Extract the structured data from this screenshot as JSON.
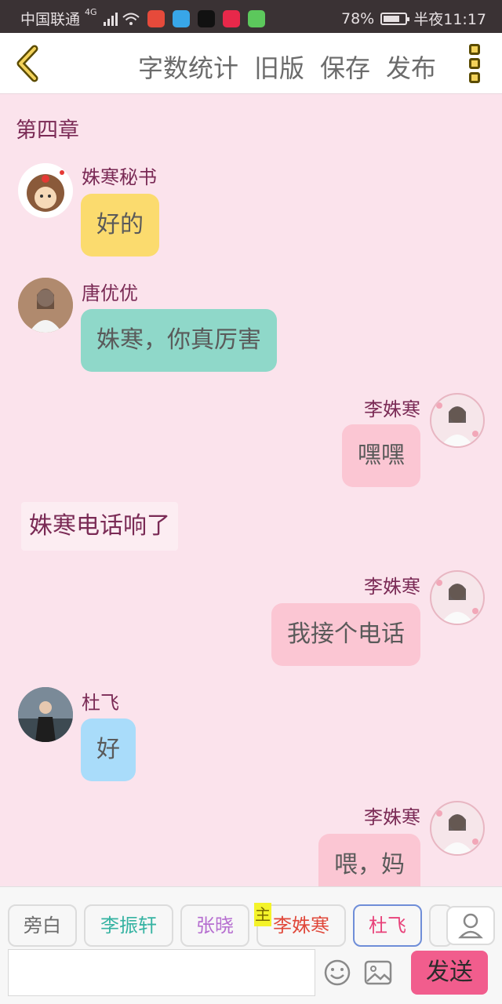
{
  "status_bar": {
    "carrier": "中国联通",
    "network": "4G",
    "battery": "78%",
    "battery_level": 0.78,
    "time": "半夜11:17"
  },
  "header": {
    "actions": [
      "字数统计",
      "旧版",
      "保存",
      "发布"
    ],
    "back_icon": "chevron-left-icon",
    "more_icon": "more-vertical-icon"
  },
  "chat": {
    "chapter_title": "第四章",
    "messages": [
      {
        "speaker": "姝寒秘书",
        "text": "好的",
        "side": "left",
        "color": "#fbdb6e"
      },
      {
        "speaker": "唐优优",
        "text": "姝寒，你真厉害",
        "side": "left",
        "color": "#8fd8c9"
      },
      {
        "speaker": "李姝寒",
        "text": "嘿嘿",
        "side": "right",
        "color": "#fbc6d3"
      },
      {
        "narration": "姝寒电话响了"
      },
      {
        "speaker": "李姝寒",
        "text": "我接个电话",
        "side": "right",
        "color": "#fbc6d3"
      },
      {
        "speaker": "杜飞",
        "text": "好",
        "side": "left",
        "color": "#a9dcfa"
      },
      {
        "speaker": "李姝寒",
        "text": "喂，妈",
        "side": "right",
        "color": "#fbc6d3"
      }
    ]
  },
  "role_bar": {
    "roles": [
      {
        "label": "旁白",
        "color": "#6b6b6b"
      },
      {
        "label": "李振轩",
        "color": "#36b3a2"
      },
      {
        "label": "张晓",
        "color": "#b66fd0"
      },
      {
        "label": "李姝寒",
        "color": "#e0483a",
        "main": true
      },
      {
        "label": "杜飞",
        "color": "#e8427a",
        "selected": true
      }
    ],
    "main_tag": "主"
  },
  "composer": {
    "input_value": "",
    "send_label": "发送"
  }
}
